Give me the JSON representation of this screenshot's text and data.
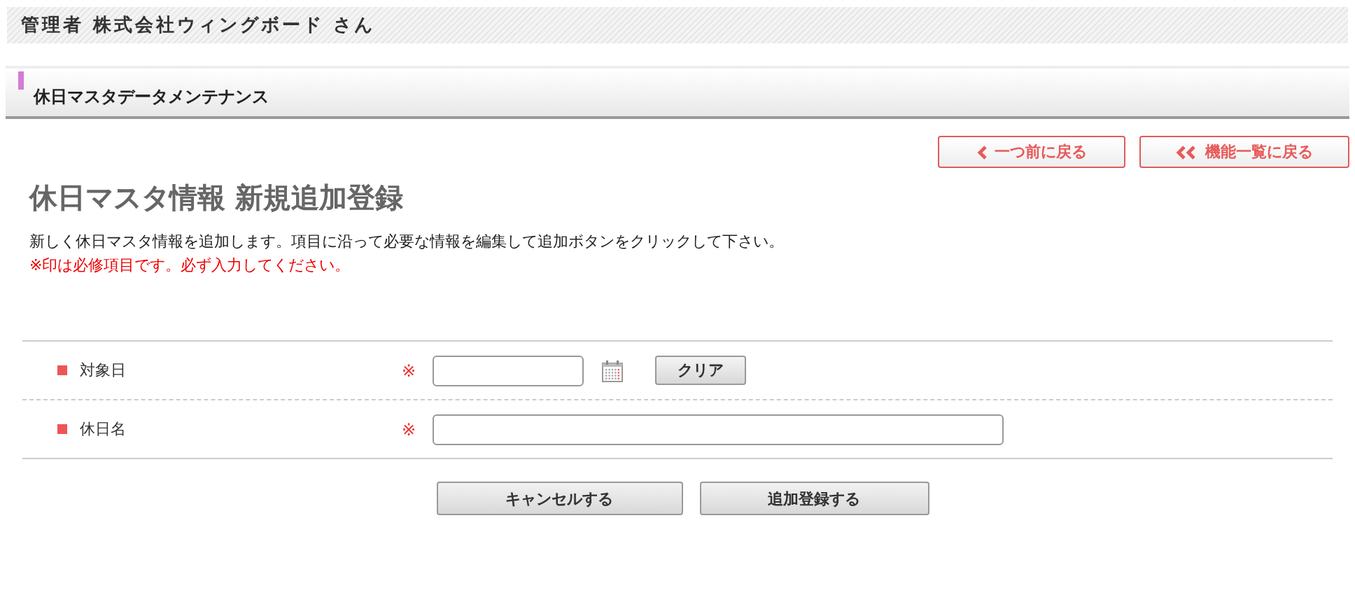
{
  "header": {
    "user": "管理者 株式会社ウィングボード さん"
  },
  "section_title": "休日マスタデータメンテナンス",
  "nav_buttons": [
    {
      "label": "一つ前に戻る",
      "kind": "single"
    },
    {
      "label": "機能一覧に戻る",
      "kind": "double"
    }
  ],
  "heading": "休日マスタ情報 新規追加登録",
  "description": "新しく休日マスタ情報を追加します。項目に沿って必要な情報を編集して追加ボタンをクリックして下さい。",
  "required_note": "※印は必修項目です。必ず入力してください。",
  "fields": [
    {
      "label": "対象日",
      "required_mark": "※",
      "kind": "date",
      "clear_button": "クリア"
    },
    {
      "label": "休日名",
      "required_mark": "※",
      "kind": "text"
    }
  ],
  "actions": [
    "キャンセルする",
    "追加登録する"
  ]
}
